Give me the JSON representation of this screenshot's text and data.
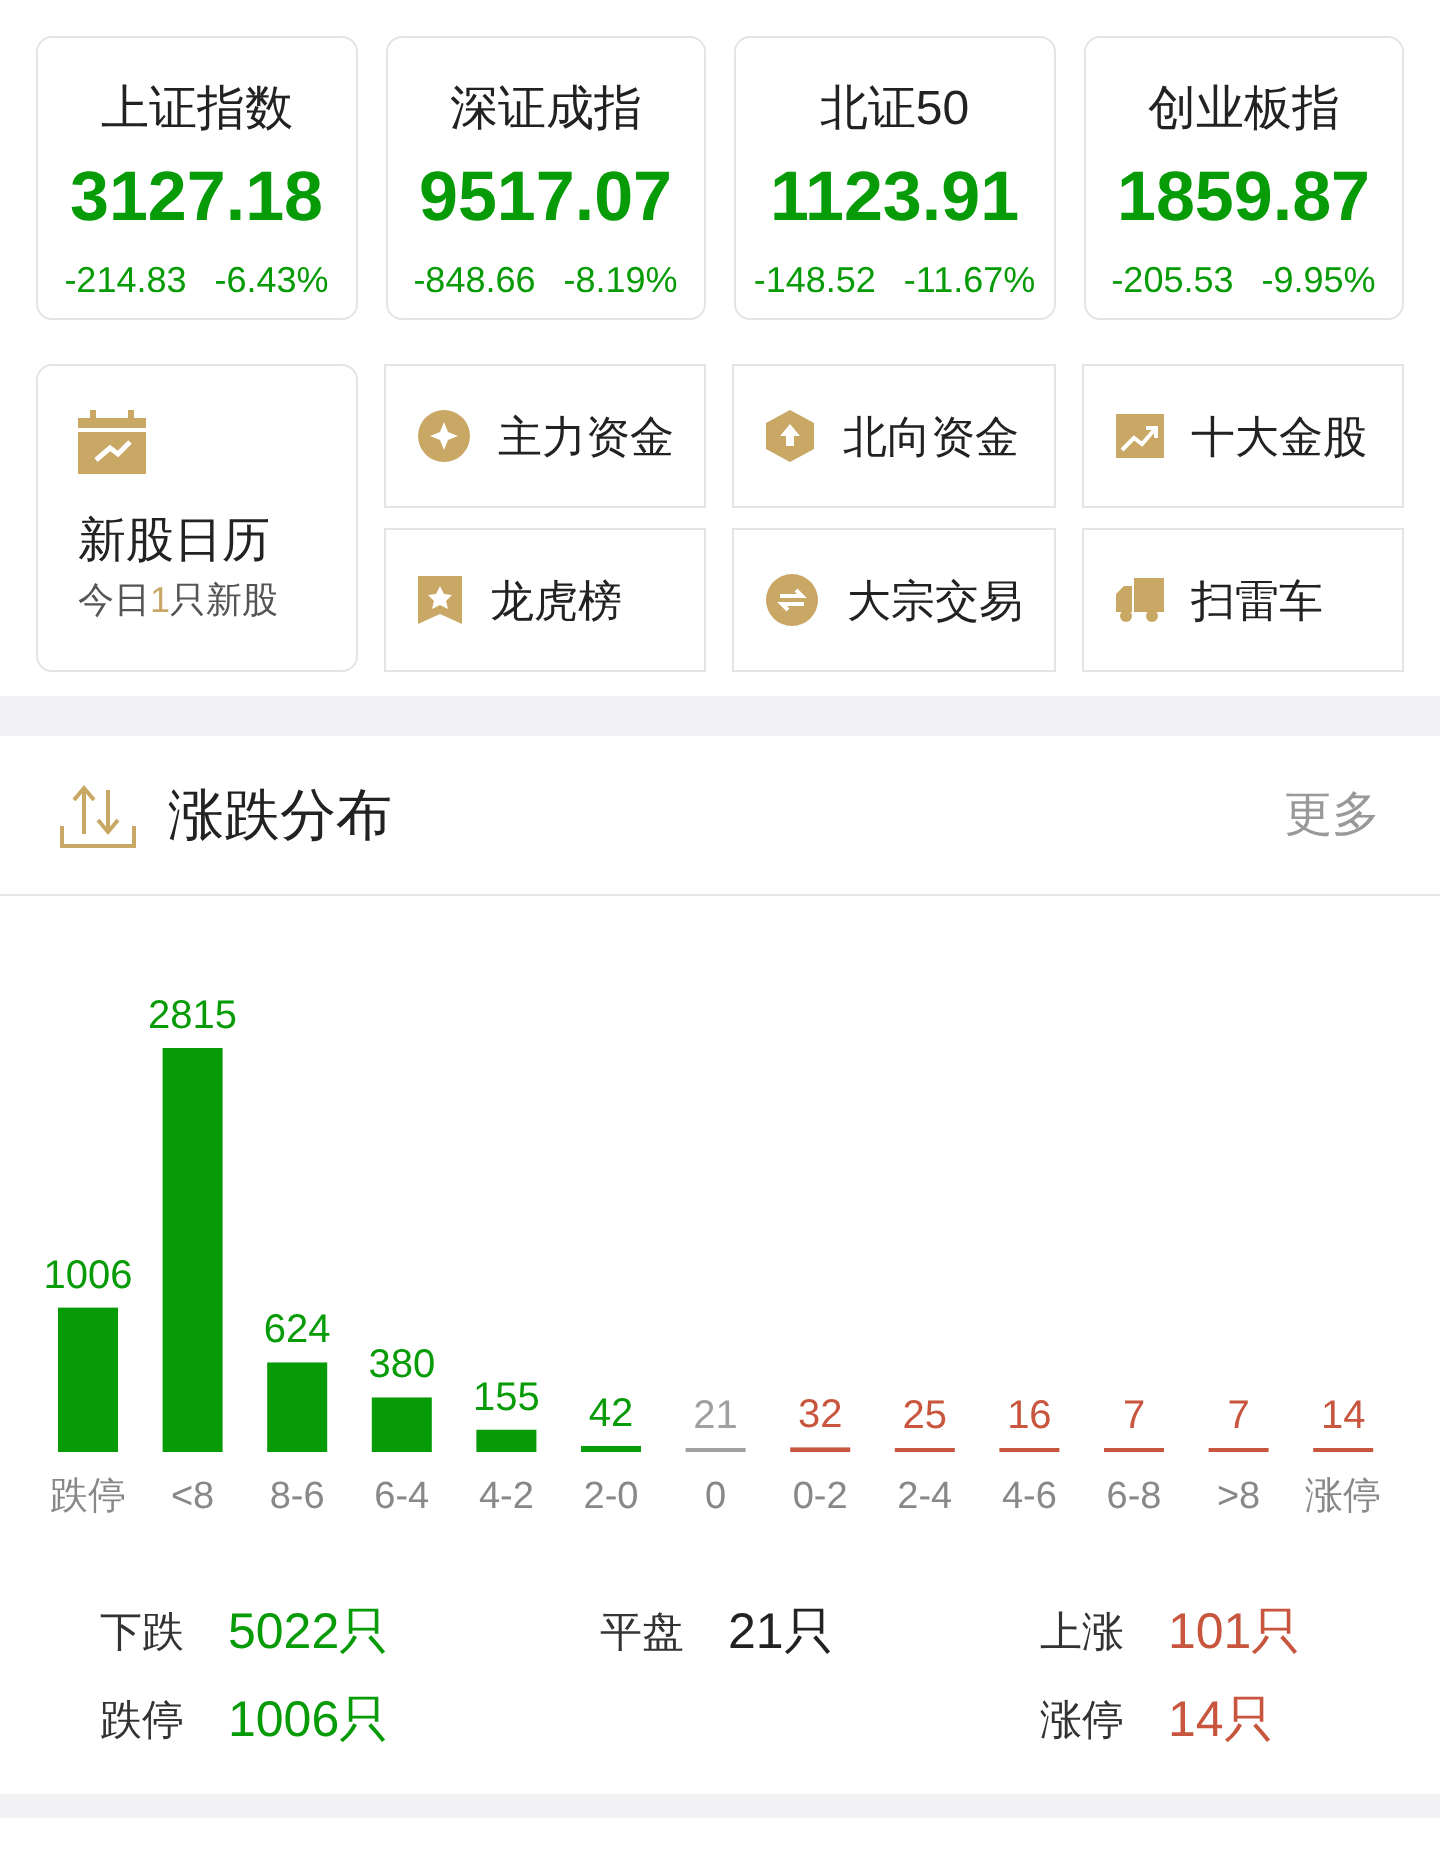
{
  "indices": [
    {
      "name": "上证指数",
      "value": "3127.18",
      "change": "-214.83",
      "percent": "-6.43%"
    },
    {
      "name": "深证成指",
      "value": "9517.07",
      "change": "-848.66",
      "percent": "-8.19%"
    },
    {
      "name": "北证50",
      "value": "1123.91",
      "change": "-148.52",
      "percent": "-11.67%"
    },
    {
      "name": "创业板指",
      "value": "1859.87",
      "change": "-205.53",
      "percent": "-9.95%"
    }
  ],
  "calendar": {
    "title": "新股日历",
    "subtitle": "今日**1**只新股"
  },
  "shortcuts": [
    {
      "kind": "coin",
      "label": "主力资金"
    },
    {
      "kind": "hexagon",
      "label": "北向资金"
    },
    {
      "kind": "chart",
      "label": "十大金股"
    },
    {
      "kind": "ribbon",
      "label": "龙虎榜"
    },
    {
      "kind": "swap",
      "label": "大宗交易"
    },
    {
      "kind": "truck",
      "label": "扫雷车"
    }
  ],
  "distribution": {
    "title": "涨跌分布",
    "more": "更多",
    "chart_data": {
      "type": "bar",
      "data_labels": true,
      "categories": [
        "跌停",
        "<8",
        "8-6",
        "6-4",
        "4-2",
        "2-0",
        "0",
        "0-2",
        "2-4",
        "4-6",
        "6-8",
        ">8",
        "涨停"
      ],
      "series": [
        {
          "color": "#079b07",
          "values": [
            1006,
            2815,
            624,
            380,
            155,
            42,
            null,
            null,
            null,
            null,
            null,
            null,
            null
          ]
        },
        {
          "color": "#a0a0a0",
          "values": [
            null,
            null,
            null,
            null,
            null,
            null,
            21,
            null,
            null,
            null,
            null,
            null,
            null
          ]
        },
        {
          "color": "#c8553d",
          "values": [
            null,
            null,
            null,
            null,
            null,
            null,
            null,
            32,
            25,
            16,
            7,
            7,
            14
          ]
        }
      ]
    },
    "summary": [
      {
        "label": "下跌",
        "value": "5022只",
        "color": "#079b07"
      },
      {
        "label": "平盘",
        "value": "21只",
        "color": "#222222"
      },
      {
        "label": "上涨",
        "value": "101只",
        "color": "#c8553d"
      },
      {
        "label": "跌停",
        "value": "1006只",
        "color": "#079b07"
      },
      {
        "label": "涨停",
        "value": "14只",
        "color": "#c8553d"
      }
    ]
  }
}
